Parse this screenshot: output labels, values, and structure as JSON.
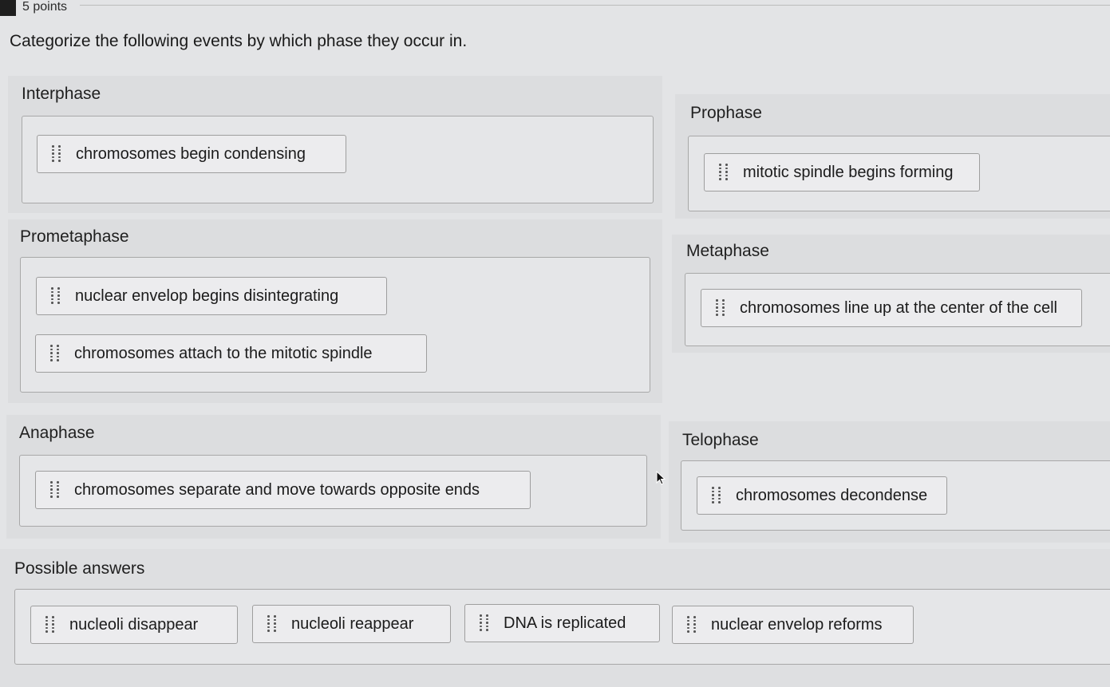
{
  "header": {
    "points": "5 points",
    "question": "Categorize the following events by which phase they occur in."
  },
  "categories": {
    "interphase": {
      "label": "Interphase",
      "items": [
        "chromosomes begin condensing"
      ]
    },
    "prophase": {
      "label": "Prophase",
      "items": [
        "mitotic spindle begins forming"
      ]
    },
    "prometaphase": {
      "label": "Prometaphase",
      "items": [
        "nuclear envelop begins disintegrating",
        "chromosomes attach to the mitotic spindle"
      ]
    },
    "metaphase": {
      "label": "Metaphase",
      "items": [
        "chromosomes line up at the center of the cell"
      ]
    },
    "anaphase": {
      "label": "Anaphase",
      "items": [
        "chromosomes separate and move towards opposite ends"
      ]
    },
    "telophase": {
      "label": "Telophase",
      "items": [
        "chromosomes decondense"
      ]
    }
  },
  "possible_answers": {
    "label": "Possible answers",
    "items": [
      "nucleoli disappear",
      "nucleoli reappear",
      "DNA is replicated",
      "nuclear envelop reforms"
    ]
  },
  "icons": {
    "drag_handle": "drag-handle-icon",
    "cursor": "mouse-pointer-icon"
  },
  "colors": {
    "background": "#e3e4e6",
    "border": "#a8a8a8",
    "text": "#1f1f1f"
  }
}
